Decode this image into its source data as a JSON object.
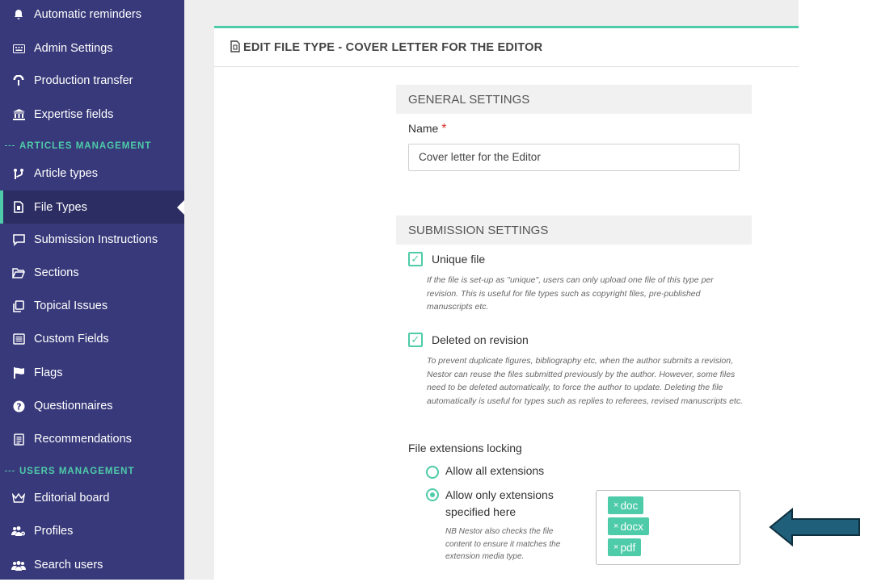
{
  "sidebar": {
    "items": [
      {
        "label": "Automatic reminders",
        "icon": "bell-icon"
      },
      {
        "label": "Admin Settings",
        "icon": "keyboard-icon"
      },
      {
        "label": "Production transfer",
        "icon": "transfer-icon"
      },
      {
        "label": "Expertise fields",
        "icon": "institution-icon"
      },
      {
        "label": "Article types",
        "icon": "branch-icon"
      },
      {
        "label": "File Types",
        "icon": "file-icon"
      },
      {
        "label": "Submission Instructions",
        "icon": "message-icon"
      },
      {
        "label": "Sections",
        "icon": "folder-open-icon"
      },
      {
        "label": "Topical Issues",
        "icon": "copy-icon"
      },
      {
        "label": "Custom Fields",
        "icon": "list-icon"
      },
      {
        "label": "Flags",
        "icon": "flag-icon"
      },
      {
        "label": "Questionnaires",
        "icon": "question-icon"
      },
      {
        "label": "Recommendations",
        "icon": "document-icon"
      },
      {
        "label": "Editorial board",
        "icon": "crown-icon"
      },
      {
        "label": "Profiles",
        "icon": "users-cog-icon"
      },
      {
        "label": "Search users",
        "icon": "users-icon"
      }
    ],
    "sections": {
      "articles": "ARTICLES MANAGEMENT",
      "users": "USERS MANAGEMENT"
    }
  },
  "panel": {
    "title": "EDIT FILE TYPE - COVER LETTER FOR THE EDITOR"
  },
  "general": {
    "heading": "GENERAL SETTINGS",
    "name_label": "Name",
    "required_mark": "*",
    "name_value": "Cover letter for the Editor"
  },
  "submission": {
    "heading": "SUBMISSION SETTINGS",
    "unique_label": "Unique file",
    "unique_help": "If the file is set-up as \"unique\", users can only upload one file of this type per revision. This is useful for file types such as copyright files, pre-published manuscripts etc.",
    "deleted_label": "Deleted on revision",
    "deleted_help": "To prevent duplicate figures, bibliography etc, when the author submits a revision, Nestor can reuse the files submitted previously by the author. However, some files need to be deleted automatically, to force the author to update. Deleting the file automatically is useful for types such as replies to referees, revised manuscripts etc.",
    "extensions_label": "File extensions locking",
    "allow_all_label": "Allow all extensions",
    "allow_only_label_1": "Allow only extensions",
    "allow_only_label_2": "specified here",
    "extensions_help": "NB Nestor also checks the file content to ensure it matches the extension media type.",
    "tags": [
      "doc",
      "docx",
      "pdf"
    ],
    "tag_remove": "×"
  },
  "colors": {
    "sidebar": "#38397a",
    "accent": "#4ecba9",
    "arrow": "#1f5f7a"
  }
}
